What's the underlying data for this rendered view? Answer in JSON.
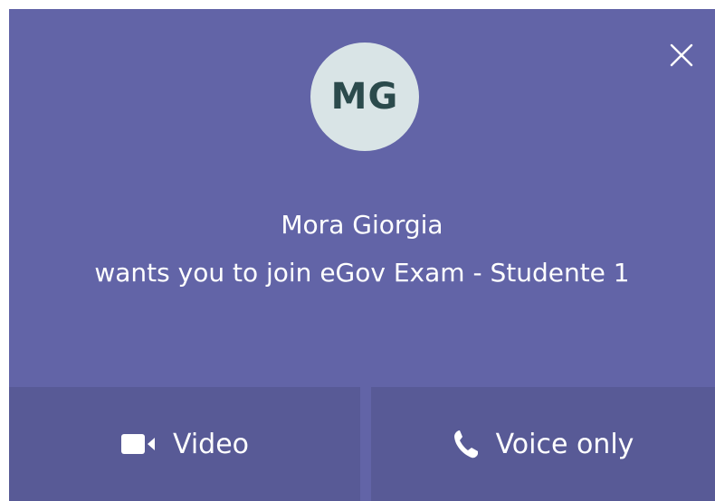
{
  "colors": {
    "background": "#6264a7",
    "button_background": "#585a96",
    "avatar_background": "#d9e4e6",
    "avatar_text": "#2b4a4c",
    "text": "#ffffff"
  },
  "caller": {
    "initials": "MG",
    "name": "Mora Giorgia"
  },
  "message": {
    "subtitle": "wants you to join eGov Exam - Studente 1"
  },
  "actions": {
    "video_label": "Video",
    "voice_label": "Voice only"
  },
  "icons": {
    "close": "close-icon",
    "video": "video-camera-icon",
    "voice": "phone-icon"
  }
}
